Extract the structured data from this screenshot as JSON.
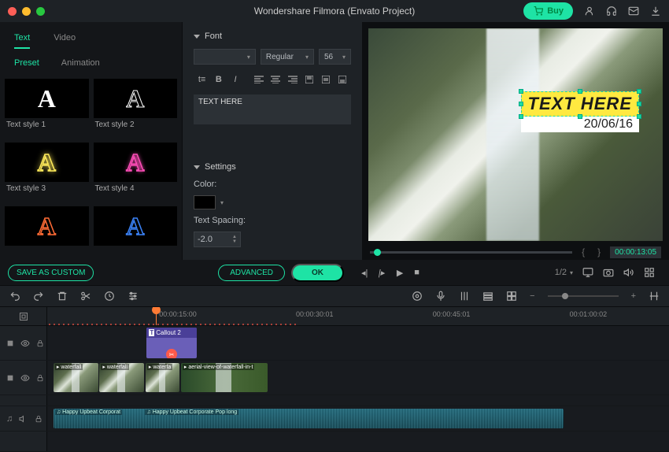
{
  "titlebar": {
    "app_title": "Wondershare Filmora (Envato Project)",
    "buy_label": "Buy"
  },
  "left_panel": {
    "tabs": [
      "Text",
      "Video"
    ],
    "active_tab": 0,
    "subtabs": [
      "Preset",
      "Animation"
    ],
    "active_subtab": 0,
    "presets": [
      {
        "label": "Text style 1"
      },
      {
        "label": "Text style 2"
      },
      {
        "label": "Text style 3"
      },
      {
        "label": "Text style 4"
      },
      {
        "label": ""
      },
      {
        "label": ""
      }
    ]
  },
  "inspector": {
    "font_section": "Font",
    "font_weight": "Regular",
    "font_size": "56",
    "text_content": "TEXT HERE",
    "settings_section": "Settings",
    "color_label": "Color:",
    "spacing_label": "Text Spacing:",
    "spacing_value": "-2.0"
  },
  "actions": {
    "save_custom": "SAVE AS CUSTOM",
    "advanced": "ADVANCED",
    "ok": "OK"
  },
  "preview": {
    "overlay_text": "TEXT HERE",
    "overlay_date": "20/06/16",
    "timecode": "00:00:13:05",
    "ratio": "1/2"
  },
  "timeline": {
    "marks": [
      "00:00:15:00",
      "00:00:30:01",
      "00:00:45:01",
      "00:01:00:02"
    ],
    "text_clip": "Callout 2",
    "video_clips": [
      "waterfall",
      "waterfall",
      "waterfa",
      "aerial-view-of-waterfall-in-t"
    ],
    "audio_clip1": "Happy Upbeat Corporat",
    "audio_clip2": "Happy Upbeat Corporate Pop long"
  }
}
